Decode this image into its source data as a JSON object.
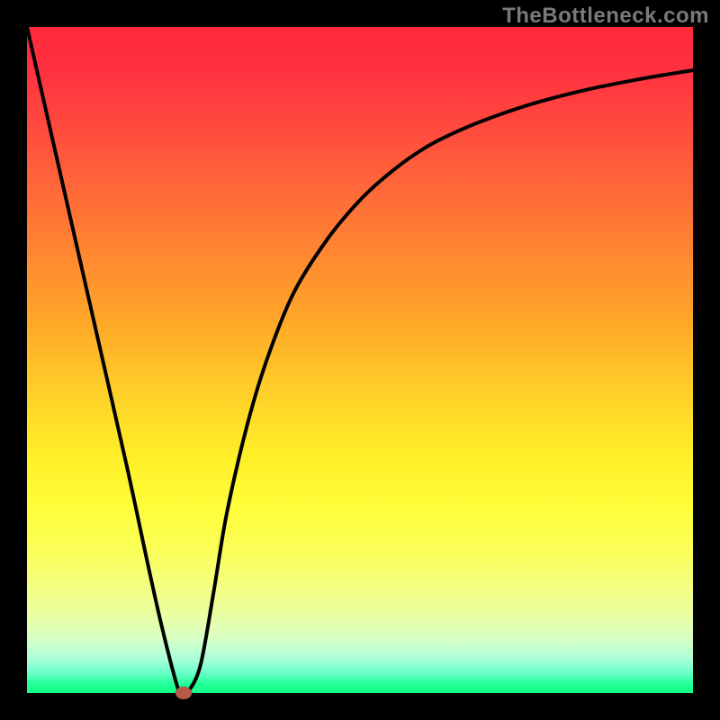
{
  "watermark": "TheBottleneck.com",
  "colors": {
    "frame": "#000000",
    "curve_stroke": "#000000",
    "marker_fill": "#b85a4a"
  },
  "chart_data": {
    "type": "line",
    "title": "",
    "xlabel": "",
    "ylabel": "",
    "xlim": [
      0,
      100
    ],
    "ylim": [
      0,
      100
    ],
    "grid": false,
    "legend": false,
    "series": [
      {
        "name": "bottleneck-curve",
        "x": [
          0,
          5,
          10,
          15,
          18,
          20,
          22,
          23,
          24,
          26,
          28,
          30,
          33,
          36,
          40,
          45,
          50,
          55,
          60,
          65,
          70,
          75,
          80,
          85,
          90,
          95,
          100
        ],
        "y": [
          100,
          78,
          56,
          34,
          20,
          11,
          3,
          0,
          0,
          4,
          15,
          27,
          40,
          50,
          60,
          68,
          74,
          78.5,
          82,
          84.5,
          86.5,
          88.2,
          89.6,
          90.8,
          91.8,
          92.7,
          93.5
        ]
      }
    ],
    "marker": {
      "x": 23.5,
      "y": 0
    },
    "gradient_stops": [
      {
        "pos": 0,
        "color": "#ff2a3a"
      },
      {
        "pos": 0.35,
        "color": "#ff8a30"
      },
      {
        "pos": 0.65,
        "color": "#fff028"
      },
      {
        "pos": 0.88,
        "color": "#ecffa0"
      },
      {
        "pos": 1.0,
        "color": "#10ff88"
      }
    ]
  }
}
